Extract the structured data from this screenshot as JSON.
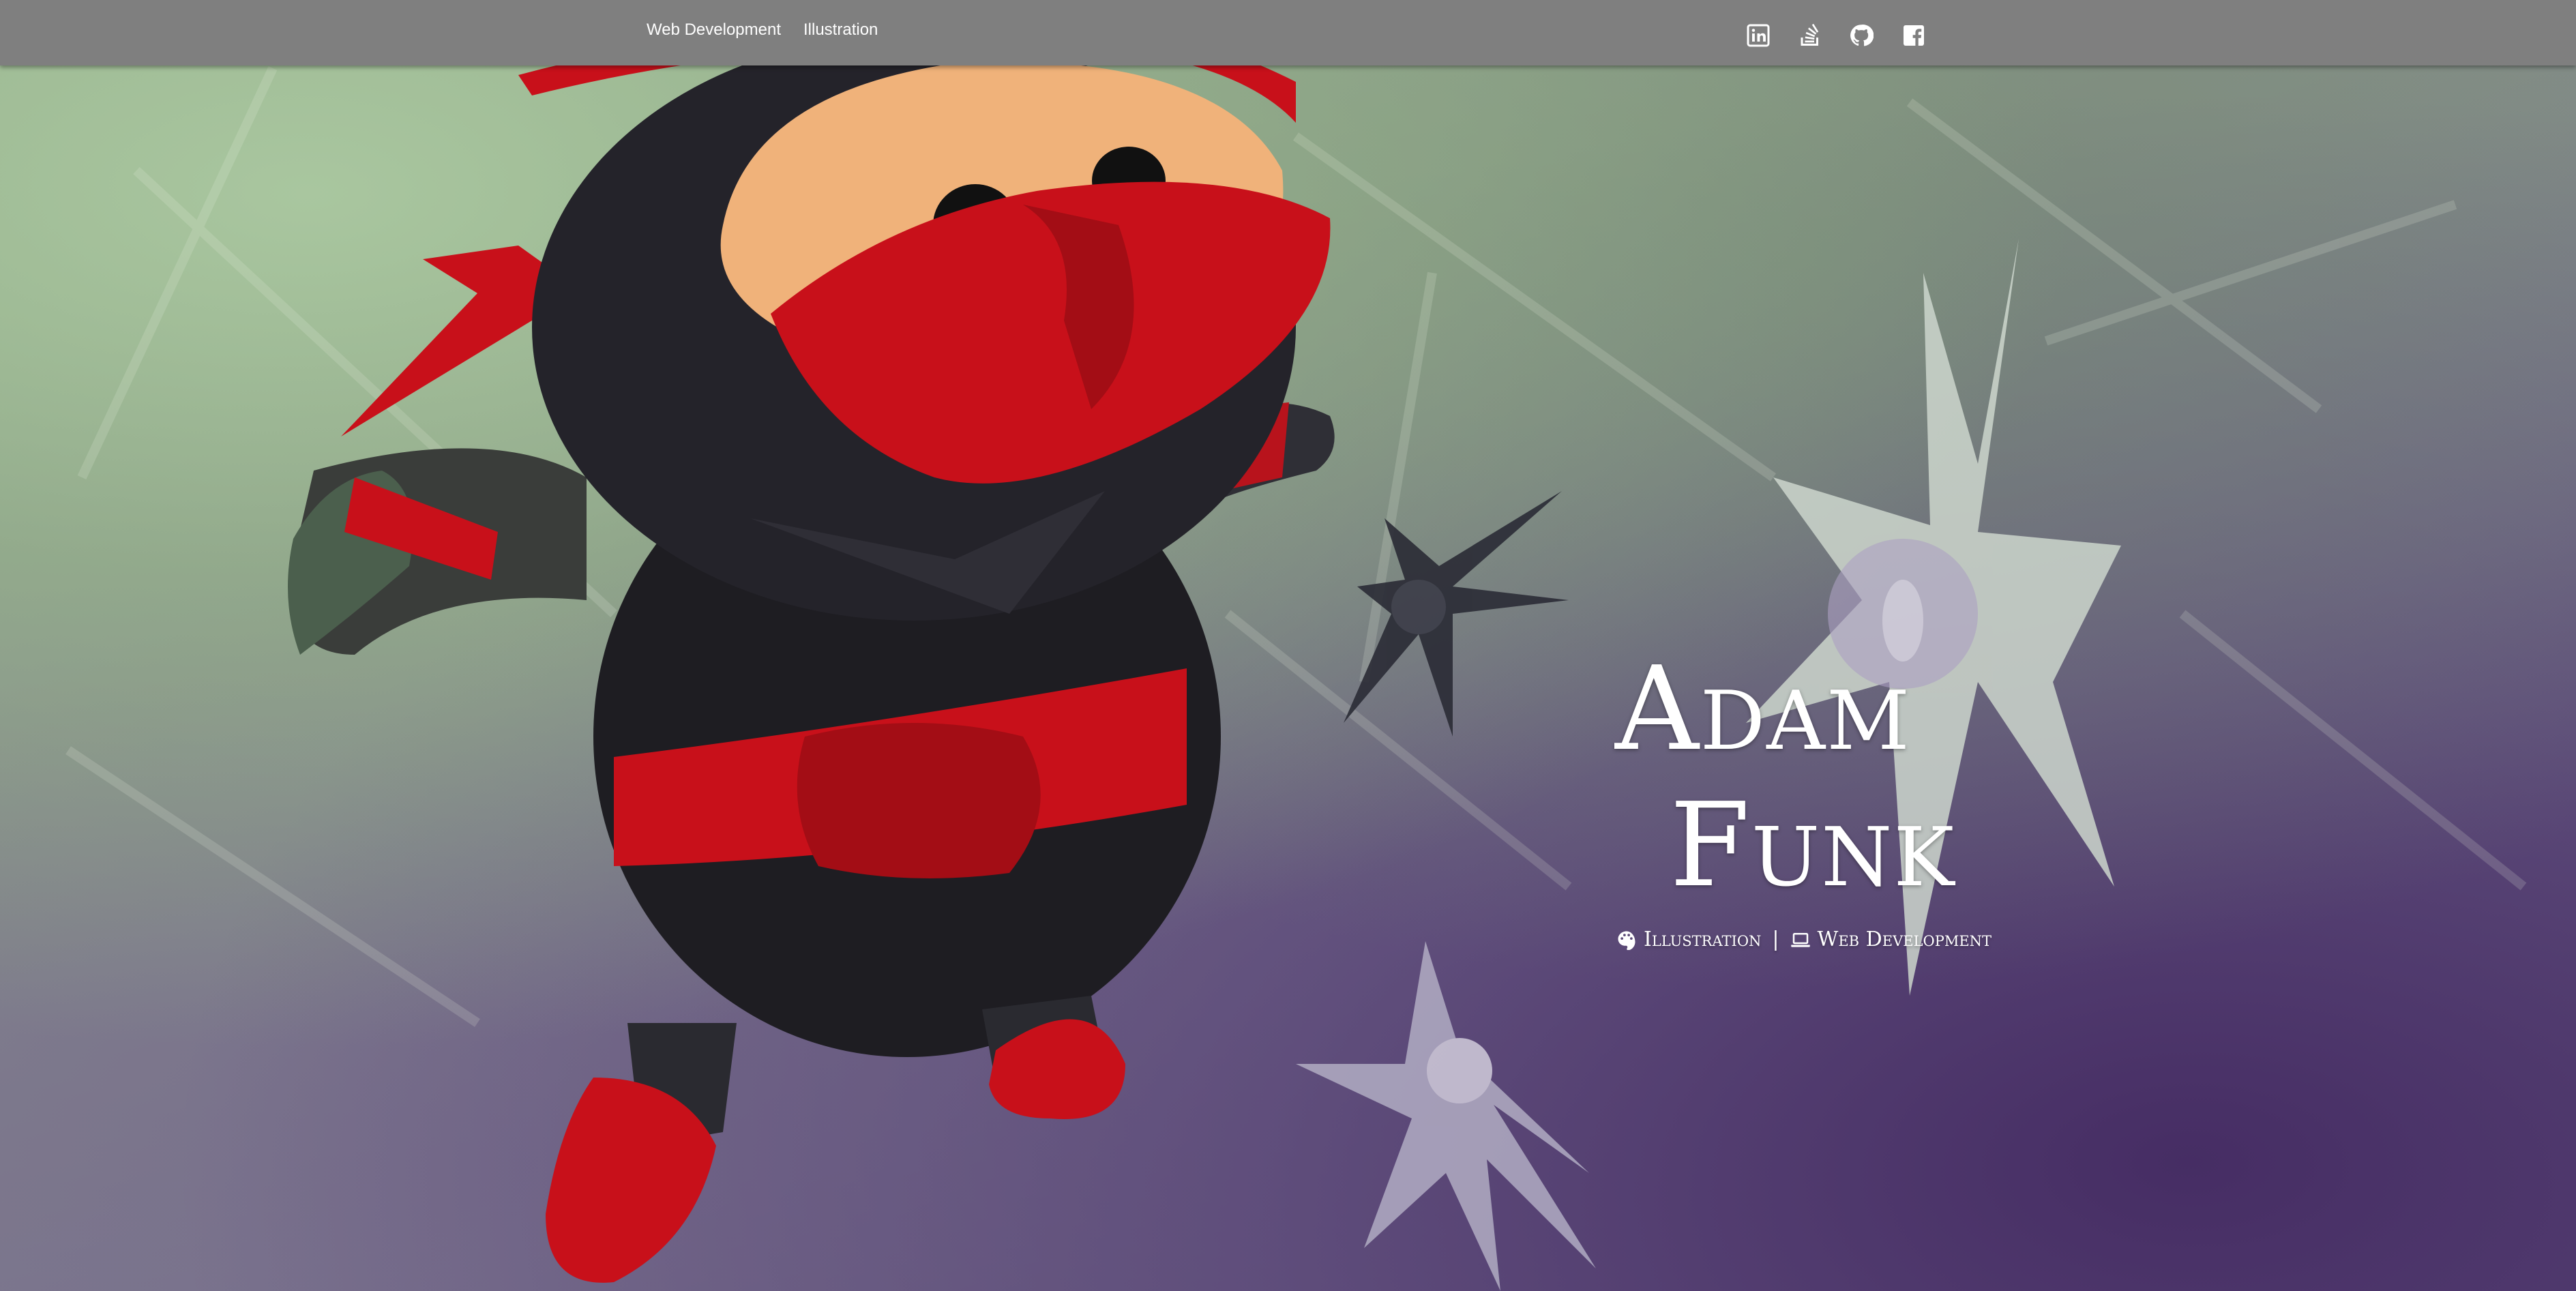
{
  "nav": {
    "links": [
      "Web Development",
      "Illustration"
    ],
    "social": [
      "linkedin-icon",
      "stackoverflow-icon",
      "github-icon",
      "facebook-icon"
    ]
  },
  "hero": {
    "title_first": "Adam",
    "title_second": "Funk",
    "subtitle": {
      "illustration": "Illustration",
      "separator": "|",
      "webdev": "Web Development"
    }
  },
  "colors": {
    "navbar": "#7f7f7f",
    "text": "#ffffff",
    "ninja_red": "#c8101a",
    "ninja_black": "#1e1d22",
    "ninja_skin": "#f0b27a"
  }
}
